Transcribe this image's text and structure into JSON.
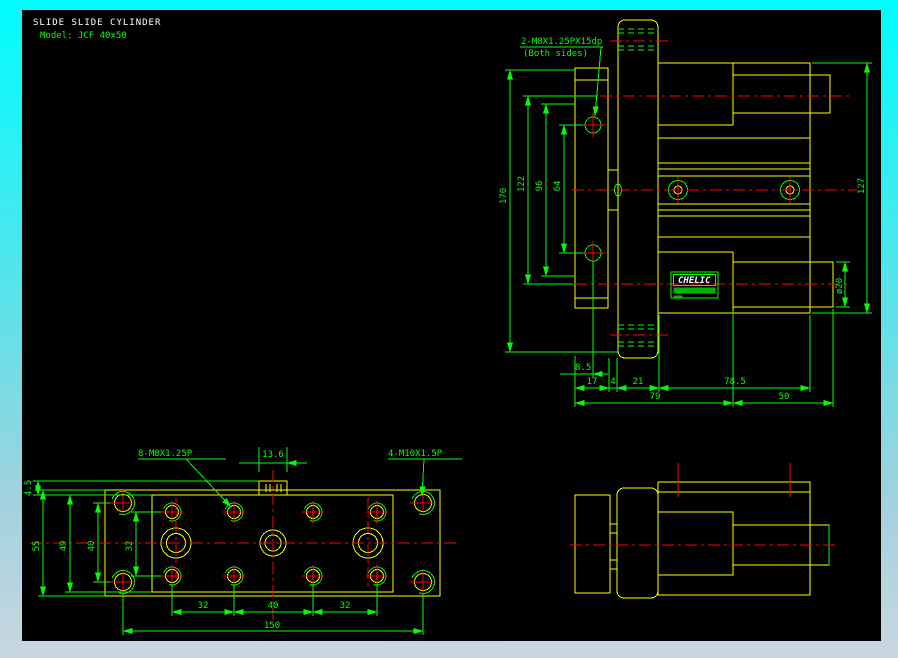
{
  "window": {
    "title": "SLIDE SLIDE CYLINDER",
    "model": "Model: JCF 40x50"
  },
  "colors": {
    "canvas_bg": "#000000",
    "geometry_yellow": "#ffff00",
    "dimension_green": "#00ff00",
    "centerline_red": "#ff0000",
    "title_white": "#ffffff",
    "frame_top": "#00fdfd",
    "frame_bottom": "#c9d7e0"
  },
  "front_view": {
    "thread_note": "2-M8X1.25PX15dp",
    "thread_note_sub": "(Both sides)",
    "nameplate_brand": "CHELIC",
    "dims": {
      "d170": "170",
      "d122": "122",
      "d96": "96",
      "d64": "64",
      "d127": "127",
      "rod_dia": "ø20",
      "d8_5": "8.5",
      "d17": "17",
      "d4": "4",
      "d21": "21",
      "d78_5": "78.5",
      "d79": "79",
      "d50": "50"
    }
  },
  "plan_view": {
    "note_m8": "8-M8X1.25P",
    "note_m10": "4-M10X1.5P",
    "dims": {
      "d13_6": "13.6",
      "d4_5": "4.5",
      "d55": "55",
      "d49": "49",
      "d40": "40",
      "d32": "32",
      "b32a": "32",
      "b40": "40",
      "b32b": "32",
      "b150": "150"
    }
  }
}
